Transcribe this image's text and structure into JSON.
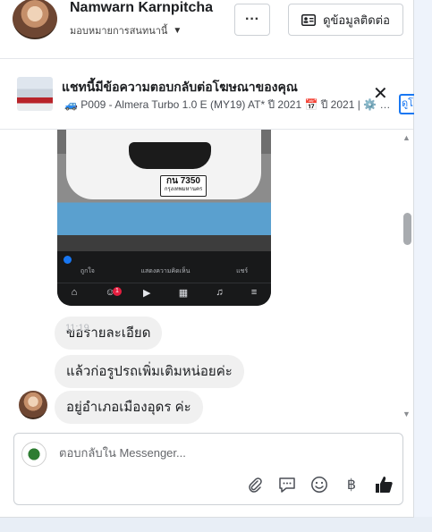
{
  "header": {
    "name": "Namwarn Karnpitcha",
    "assign_label": "มอบหมายการสนทนานี้",
    "more_label": "···",
    "contact_label": "ดูข้อมูลติดต่อ"
  },
  "ad": {
    "title": "แชทนี้มีข้อความตอบกลับต่อโฆษณาของคุณ",
    "subtitle": "🚙 P009 - Almera Turbo 1.0 E (MY19) AT* ปี 2021 📅 ปี 2021 | ⚙️ เ...",
    "close_label": "✕",
    "view_label": "ดูโ"
  },
  "image_message": {
    "plate_number": "กน 7350",
    "plate_province": "กรุงเทพมหานคร",
    "actions": [
      "ถูกใจ",
      "แสดงความคิดเห็น",
      "แชร์"
    ],
    "badge_count": "1"
  },
  "messages": [
    {
      "text": "ขอรายละเอียด",
      "time": "11:19"
    },
    {
      "text": "แล้วก่อรูปรถเพิ่มเติมหน่อยค่ะ"
    },
    {
      "text": "อยู่อำเภอเมืองอุดร ค่ะ"
    }
  ],
  "composer": {
    "placeholder": "ตอบกลับใน Messenger..."
  },
  "icons": {
    "attach": "paperclip-icon",
    "saved_reply": "chat-bubble-icon",
    "emoji": "smiley-icon",
    "currency": "baht-icon",
    "like": "thumbs-up-icon"
  },
  "colors": {
    "accent": "#1877f2",
    "bubble": "#f0f0f0",
    "badge": "#e41e3f"
  }
}
